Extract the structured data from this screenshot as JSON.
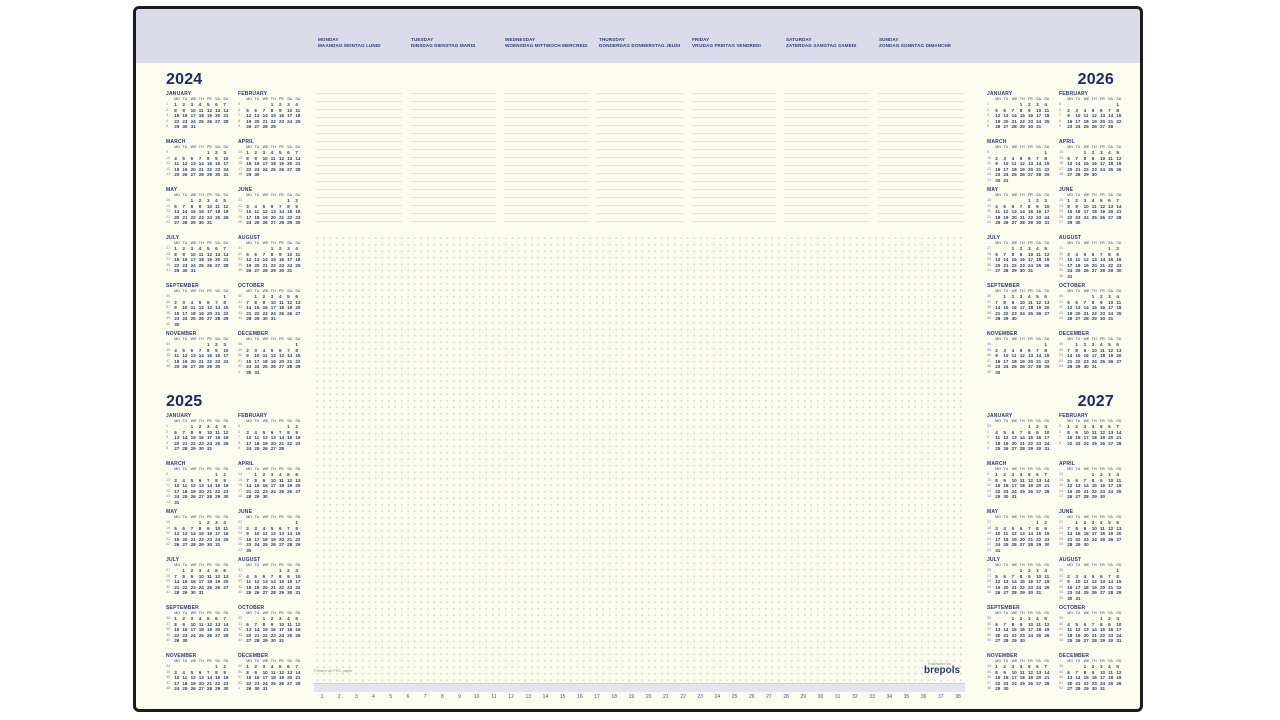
{
  "week_days": [
    {
      "en": "MONDAY",
      "other": "MAANDAG MONTAG LUNDI"
    },
    {
      "en": "TUESDAY",
      "other": "DINSDAG DIENSTAG MARDI"
    },
    {
      "en": "WEDNESDAY",
      "other": "WOENSDAG MITTWOCH MERCREDI"
    },
    {
      "en": "THURSDAY",
      "other": "DONDERDAG DONNERSTAG JEUDI"
    },
    {
      "en": "FRIDAY",
      "other": "VRIJDAG FREITAG VENDREDI"
    },
    {
      "en": "SATURDAY",
      "other": "ZATERDAG SAMSTAG SAMEDI"
    },
    {
      "en": "SUNDAY",
      "other": "ZONDAG SONNTAG DIMANCHE"
    }
  ],
  "dow": [
    "MO",
    "TU",
    "WE",
    "TH",
    "FR",
    "SA",
    "SU"
  ],
  "month_names": [
    "JANUARY",
    "FEBRUARY",
    "MARCH",
    "APRIL",
    "MAY",
    "JUNE",
    "JULY",
    "AUGUST",
    "SEPTEMBER",
    "OCTOBER",
    "NOVEMBER",
    "DECEMBER"
  ],
  "calendars": [
    {
      "year": "2024"
    },
    {
      "year": "2025"
    },
    {
      "year": "2026"
    },
    {
      "year": "2027"
    }
  ],
  "footer": {
    "paper_note": "Printed on FSC paper",
    "publisher_label": "Published by",
    "brand": "brepols"
  },
  "ruler": {
    "from": 1,
    "to": 38
  }
}
